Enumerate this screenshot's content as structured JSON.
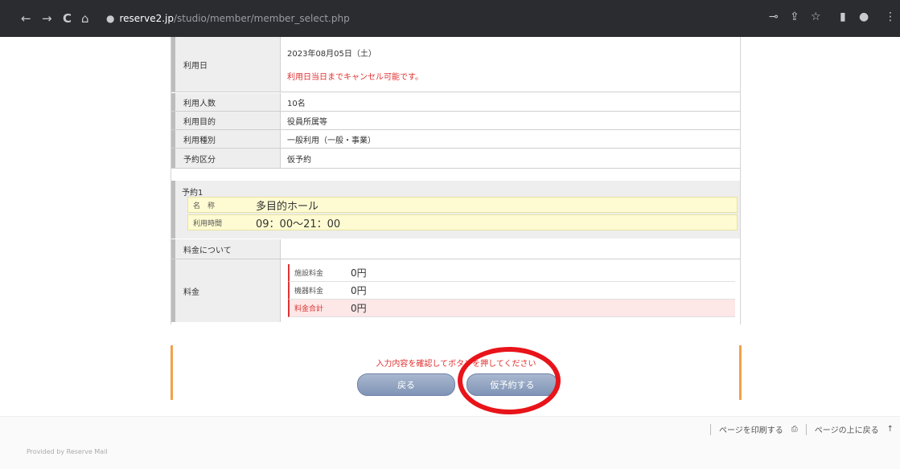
{
  "browser": {
    "url_host": "reserve2.jp",
    "url_path": "/studio/member/member_select.php",
    "back_icon": "←",
    "forward_icon": "→",
    "reload_icon": "C",
    "home_icon": "⌂"
  },
  "form": {
    "date_label": "利用日",
    "date_value": "2023年08月05日（土）",
    "date_note": "利用日当日までキャンセル可能です。",
    "people_label": "利用人数",
    "people_value": "10名",
    "purpose_label": "利用目的",
    "purpose_value": "役員所属等",
    "type_label": "利用種別",
    "type_value": "一般利用（一般・事業）",
    "division_label": "予約区分",
    "division_value": "仮予約",
    "reservation_head": "予約1",
    "name_label": "名　称",
    "name_value": "多目的ホール",
    "time_label": "利用時間",
    "time_value": "09：00〜21：00",
    "fee_about_label": "料金について",
    "fee_label": "料金",
    "fees": [
      {
        "label": "施設料金",
        "value": "0円"
      },
      {
        "label": "機器料金",
        "value": "0円"
      },
      {
        "label": "料金合計",
        "value": "0円"
      }
    ]
  },
  "confirm": {
    "message": "入力内容を確認してボタンを押してください",
    "back_label": "戻る",
    "submit_label": "仮予約する"
  },
  "footer": {
    "print_label": "ページを印刷する",
    "top_label": "ページの上に戻る",
    "powered": "Provided by Reserve Mail"
  }
}
